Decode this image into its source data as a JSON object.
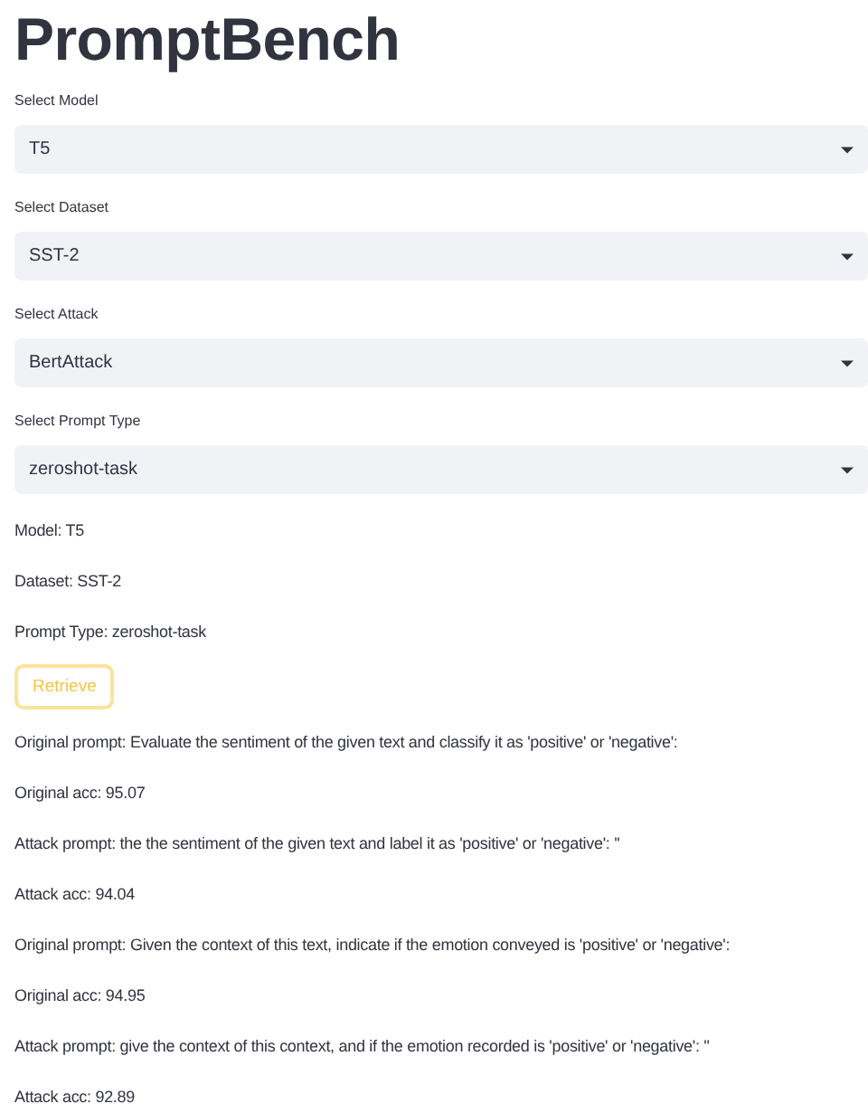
{
  "title": "PromptBench",
  "selects": [
    {
      "label": "Select Model",
      "value": "T5"
    },
    {
      "label": "Select Dataset",
      "value": "SST-2"
    },
    {
      "label": "Select Attack",
      "value": "BertAttack"
    },
    {
      "label": "Select Prompt Type",
      "value": "zeroshot-task"
    }
  ],
  "summary": [
    "Model: T5",
    "Dataset: SST-2",
    "Prompt Type: zeroshot-task"
  ],
  "button": {
    "label": "Retrieve"
  },
  "results": [
    "Original prompt: Evaluate the sentiment of the given text and classify it as 'positive' or 'negative':",
    "Original acc: 95.07",
    "Attack prompt: the the sentiment of the given text and label it as 'positive' or 'negative': ''",
    "Attack acc: 94.04",
    "Original prompt: Given the context of this text, indicate if the emotion conveyed is 'positive' or 'negative':",
    "Original acc: 94.95",
    "Attack prompt: give the context of this context, and if the emotion recorded is 'positive' or 'negative': ''",
    "Attack acc: 92.89"
  ]
}
